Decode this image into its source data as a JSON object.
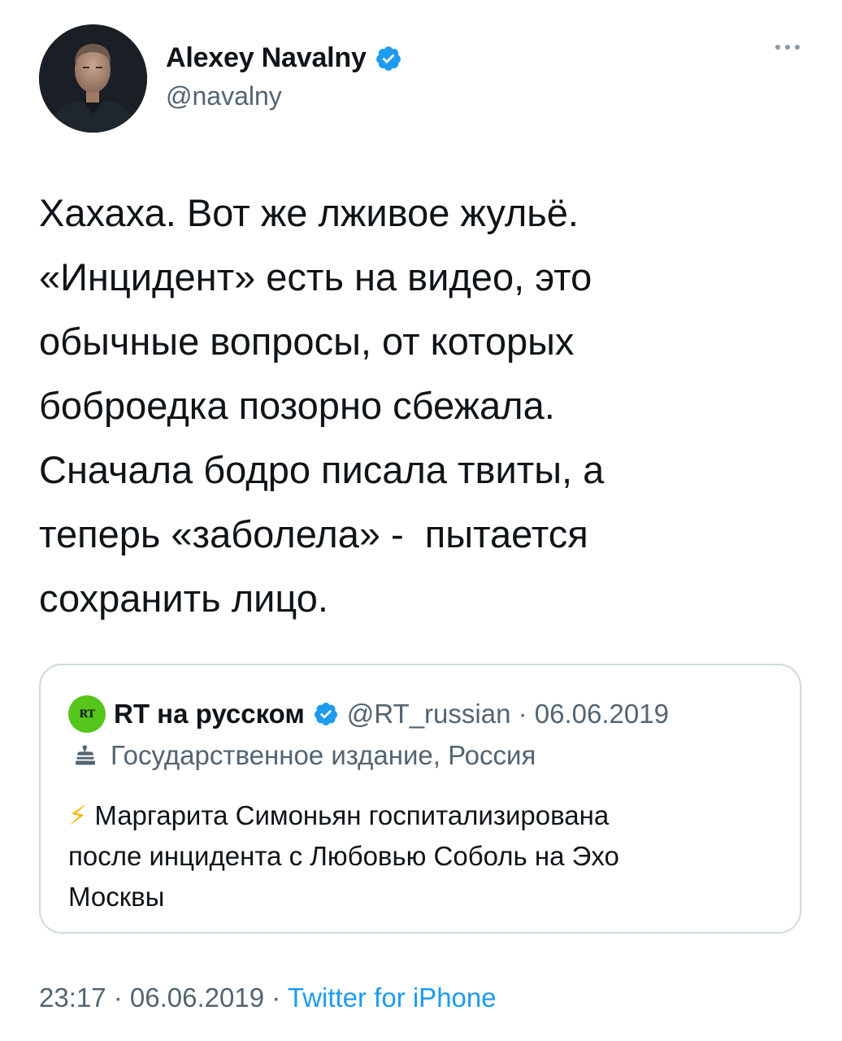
{
  "author": {
    "name": "Alexey Navalny",
    "handle": "@navalny",
    "verified_icon": "verified-badge-icon"
  },
  "tweet": {
    "lines": [
      "Хахаха. Вот же лживое жульё.",
      "«Инцидент» есть на видео, это",
      "обычные вопросы, от которых",
      "боброедка позорно сбежала.",
      "Сначала бодро писала твиты, а",
      "теперь «заболела» -  пытается",
      "сохранить лицо."
    ]
  },
  "quote": {
    "account_name": "RT на русском",
    "handle": "@RT_russian",
    "separator": " · ",
    "date": "06.06.2019",
    "label": "Государственное издание, Россия",
    "bolt": "⚡",
    "text_lines": [
      " Маргарита Симоньян госпитализирована",
      "после инцидента с Любовью Соболь на Эхо",
      "Москвы"
    ],
    "logo_text": "RT"
  },
  "meta": {
    "time": "23:17",
    "sep1": " · ",
    "date": "06.06.2019",
    "sep2": " · ",
    "source": "Twitter for iPhone"
  },
  "colors": {
    "accent": "#1d9bf0",
    "secondary_text": "#536471",
    "border": "#cfd9de",
    "rt_green": "#56c51c"
  }
}
